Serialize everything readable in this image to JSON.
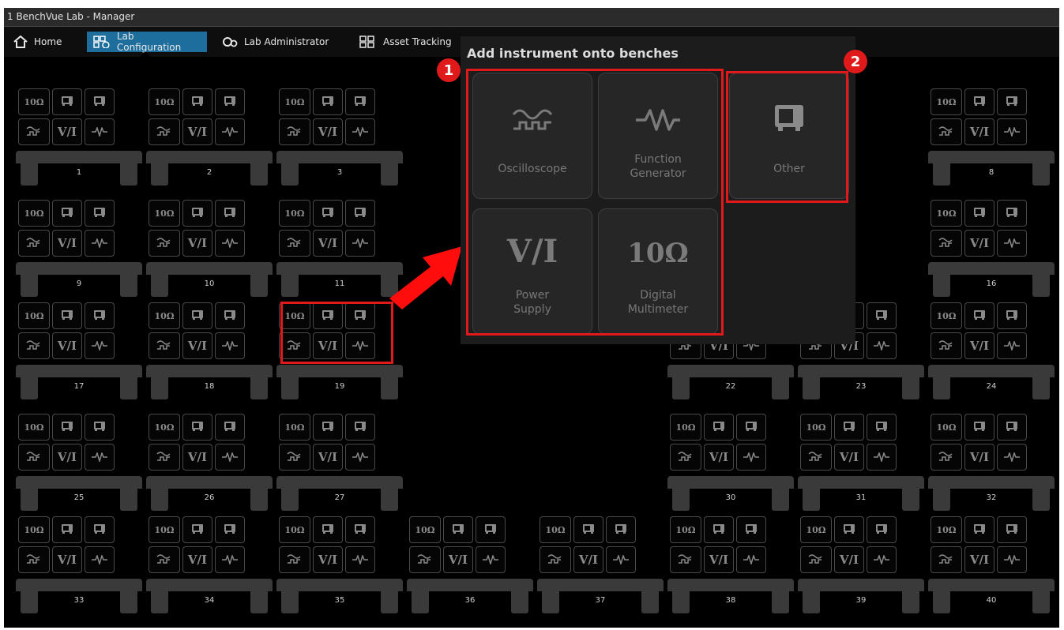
{
  "window": {
    "title": "1 BenchVue Lab - Manager"
  },
  "nav": {
    "home": "Home",
    "lab_configuration": "Lab Configuration",
    "lab_administrator": "Lab Administrator",
    "asset_tracking": "Asset Tracking"
  },
  "bench_icons": {
    "multimeter": "10Ω",
    "power_supply": "V/I"
  },
  "benches": [
    "1",
    "2",
    "3",
    "8",
    "9",
    "10",
    "11",
    "16",
    "17",
    "18",
    "19",
    "22",
    "23",
    "24",
    "25",
    "26",
    "27",
    "30",
    "31",
    "32",
    "33",
    "34",
    "35",
    "36",
    "37",
    "38",
    "39",
    "40"
  ],
  "popup": {
    "title": "Add instrument onto benches",
    "cards": {
      "oscilloscope": "Oscilloscope",
      "function_generator_1": "Function",
      "function_generator_2": "Generator",
      "other": "Other",
      "power_supply_icon": "V/I",
      "power_supply_1": "Power",
      "power_supply_2": "Supply",
      "multimeter_icon": "10Ω",
      "multimeter_1": "Digital",
      "multimeter_2": "Multimeter"
    }
  },
  "annotations": {
    "badge_1": "1",
    "badge_2": "2"
  },
  "colors": {
    "accent": "#1d6e9c",
    "highlight": "#e01a1a",
    "background": "#000000"
  },
  "icons": {
    "home": "home-icon",
    "lab_configuration": "lab-config-icon",
    "lab_administrator": "lab-admin-icon",
    "asset_tracking": "asset-tracking-icon"
  }
}
